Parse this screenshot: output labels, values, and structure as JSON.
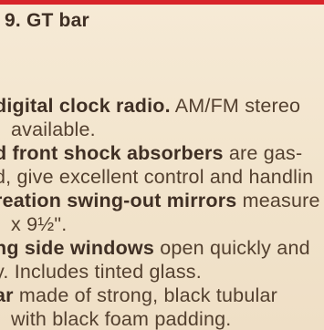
{
  "heading": "9. GT bar",
  "lines": [
    {
      "term": "digital clock radio.",
      "text": " AM/FM stereo"
    },
    {
      "term": "",
      "text": "available."
    },
    {
      "term": "d front shock absorbers",
      "text": " are gas-"
    },
    {
      "term": "",
      "text": "d, give excellent control and handlin"
    },
    {
      "term": "reation swing-out mirrors",
      "text": " measure"
    },
    {
      "term": "",
      "text": "x 9½\"."
    },
    {
      "term": "ng side windows",
      "text": " open quickly and"
    },
    {
      "term": "",
      "text": "y. Includes tinted glass."
    },
    {
      "term": "ar",
      "text": " made of strong, black tubular"
    },
    {
      "term": "",
      "text": "with black foam padding."
    }
  ]
}
